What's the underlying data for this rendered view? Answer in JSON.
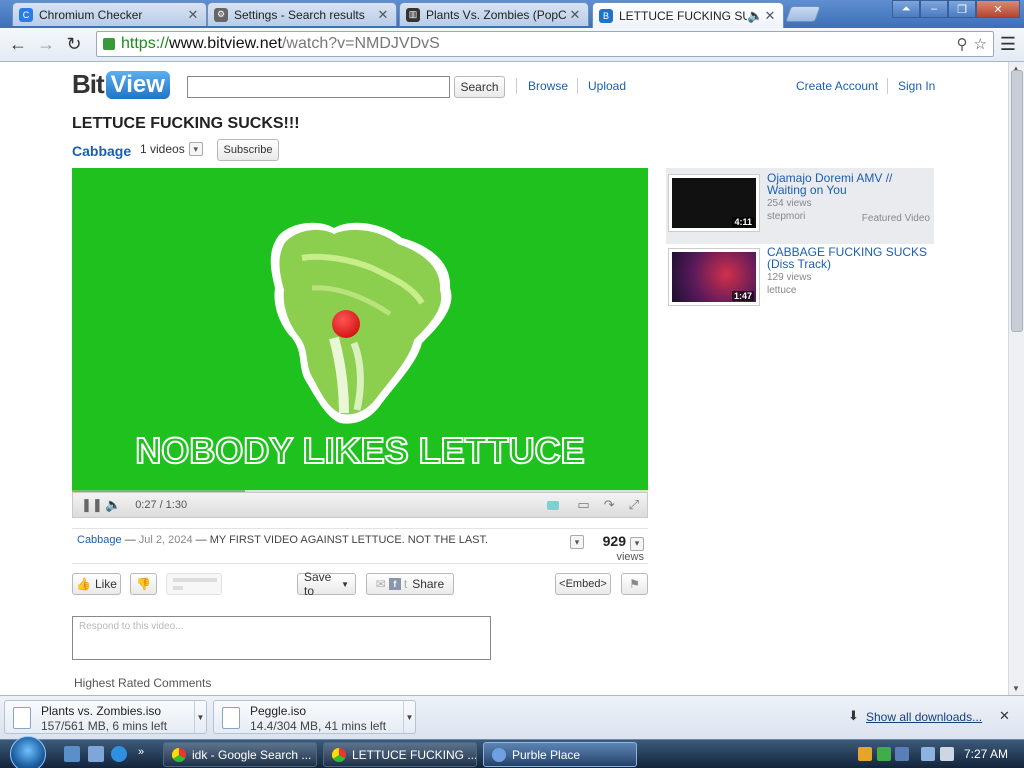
{
  "browser": {
    "tabs": [
      {
        "title": "Chromium Checker",
        "icon": "chromium-icon",
        "color": "#2c7be5"
      },
      {
        "title": "Settings - Search results",
        "icon": "gear-icon",
        "color": "#666666"
      },
      {
        "title": "Plants Vs. Zombies (PopC",
        "icon": "archive-icon",
        "color": "#333333"
      },
      {
        "title": "LETTUCE FUCKING SUC",
        "icon": "bitview-icon",
        "color": "#1f74c8"
      }
    ],
    "url": {
      "scheme": "https://",
      "host": "www.bitview.net",
      "path": "/watch?v=NMDJVDvS"
    }
  },
  "site": {
    "logo_bit": "Bit",
    "logo_view": "View",
    "search_button": "Search",
    "nav": {
      "browse": "Browse",
      "upload": "Upload",
      "create_account": "Create Account",
      "sign_in": "Sign In"
    }
  },
  "video": {
    "title": "LETTUCE FUCKING SUCKS!!!",
    "channel": "Cabbage",
    "channel_videos": "1 videos",
    "subscribe": "Subscribe",
    "overlay_text": "NOBODY LIKES LETTUCE",
    "time_current": "0:27",
    "time_total": "1:30",
    "progress": 0.3,
    "description_author": "Cabbage",
    "description_date": "Jul 2, 2024",
    "description_text": "MY FIRST VIDEO AGAINST LETTUCE. NOT THE LAST.",
    "views_count": "929",
    "views_label": "views"
  },
  "actions": {
    "like": "Like",
    "save_to": "Save to",
    "share": "Share",
    "embed": "<Embed>"
  },
  "comments": {
    "placeholder": "Respond to this video...",
    "heading": "Highest Rated Comments"
  },
  "related": [
    {
      "title": "Ojamajo Doremi AMV // Waiting on You",
      "views": "254 views",
      "author": "stepmori",
      "duration": "4:11",
      "featured": "Featured Video"
    },
    {
      "title": "CABBAGE FUCKING SUCKS (Diss Track)",
      "views": "129 views",
      "author": "lettuce",
      "duration": "1:47"
    }
  ],
  "downloads": [
    {
      "name": "Plants vs. Zombies.iso",
      "status": "157/561 MB, 6 mins left"
    },
    {
      "name": "Peggle.iso",
      "status": "14.4/304 MB, 41 mins left"
    }
  ],
  "downloads_show_all": "Show all downloads...",
  "taskbar": {
    "items": [
      {
        "label": "idk - Google Search ...",
        "icon": "chrome-icon"
      },
      {
        "label": "LETTUCE FUCKING ...",
        "icon": "chrome-icon"
      },
      {
        "label": "Purble Place",
        "icon": "purble-place-icon"
      }
    ],
    "clock": "7:27 AM"
  }
}
